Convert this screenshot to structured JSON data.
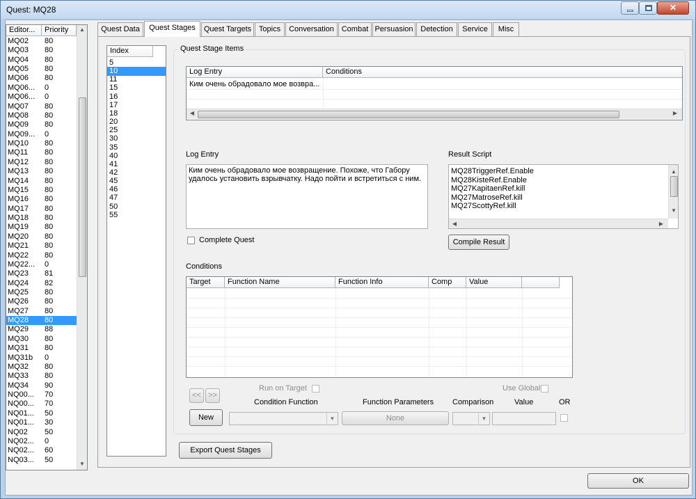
{
  "window": {
    "title": "Quest: MQ28"
  },
  "quest_list": {
    "columns": [
      "Editor...",
      "Priority"
    ],
    "rows": [
      [
        "MQ02",
        "80"
      ],
      [
        "MQ03",
        "80"
      ],
      [
        "MQ04",
        "80"
      ],
      [
        "MQ05",
        "80"
      ],
      [
        "MQ06",
        "80"
      ],
      [
        "MQ06...",
        "0"
      ],
      [
        "MQ06...",
        "0"
      ],
      [
        "MQ07",
        "80"
      ],
      [
        "MQ08",
        "80"
      ],
      [
        "MQ09",
        "80"
      ],
      [
        "MQ09...",
        "0"
      ],
      [
        "MQ10",
        "80"
      ],
      [
        "MQ11",
        "80"
      ],
      [
        "MQ12",
        "80"
      ],
      [
        "MQ13",
        "80"
      ],
      [
        "MQ14",
        "80"
      ],
      [
        "MQ15",
        "80"
      ],
      [
        "MQ16",
        "80"
      ],
      [
        "MQ17",
        "80"
      ],
      [
        "MQ18",
        "80"
      ],
      [
        "MQ19",
        "80"
      ],
      [
        "MQ20",
        "80"
      ],
      [
        "MQ21",
        "80"
      ],
      [
        "MQ22",
        "80"
      ],
      [
        "MQ22...",
        "0"
      ],
      [
        "MQ23",
        "81"
      ],
      [
        "MQ24",
        "82"
      ],
      [
        "MQ25",
        "80"
      ],
      [
        "MQ26",
        "80"
      ],
      [
        "MQ27",
        "80"
      ],
      [
        "MQ28",
        "80"
      ],
      [
        "MQ29",
        "88"
      ],
      [
        "MQ30",
        "80"
      ],
      [
        "MQ31",
        "80"
      ],
      [
        "MQ31b",
        "0"
      ],
      [
        "MQ32",
        "80"
      ],
      [
        "MQ33",
        "80"
      ],
      [
        "MQ34",
        "90"
      ],
      [
        "NQ00...",
        "70"
      ],
      [
        "NQ00...",
        "70"
      ],
      [
        "NQ01...",
        "50"
      ],
      [
        "NQ01...",
        "30"
      ],
      [
        "NQ02",
        "50"
      ],
      [
        "NQ02...",
        "0"
      ],
      [
        "NQ02...",
        "60"
      ],
      [
        "NQ03...",
        "50"
      ]
    ],
    "selected_index": 30
  },
  "tabs": [
    "Quest Data",
    "Quest Stages",
    "Quest Targets",
    "Topics",
    "Conversation",
    "Combat",
    "Persuasion",
    "Detection",
    "Service",
    "Misc"
  ],
  "active_tab": 1,
  "stage_index": {
    "header": "Index",
    "rows": [
      "5",
      "10",
      "11",
      "15",
      "16",
      "17",
      "18",
      "20",
      "25",
      "30",
      "35",
      "40",
      "41",
      "42",
      "45",
      "46",
      "47",
      "50",
      "55"
    ],
    "selected_index": 1
  },
  "stage_items": {
    "group_label": "Quest Stage Items",
    "columns": [
      "Log Entry",
      "Conditions"
    ],
    "rows": [
      [
        "Ким очень обрадовало мое возвра...",
        ""
      ]
    ]
  },
  "log_entry": {
    "label": "Log Entry",
    "text": "Ким очень обрадовало мое возвращение. Похоже, что Габору удалось установить взрывчатку. Надо пойти и встретиться с ним."
  },
  "result_script": {
    "label": "Result Script",
    "lines": [
      "MQ28TriggerRef.Enable",
      "MQ28KisteRef.Enable",
      "MQ27KapitaenRef.kill",
      "MQ27MatroseRef.kill",
      "MQ27ScottyRef.kill"
    ]
  },
  "complete_quest_label": "Complete Quest",
  "compile_result_label": "Compile Result",
  "conditions": {
    "label": "Conditions",
    "columns": [
      "Target",
      "Function Name",
      "Function Info",
      "Comp",
      "Value",
      ""
    ]
  },
  "condition_editor": {
    "prev_label": "<<",
    "next_label": ">>",
    "run_on_target_label": "Run on Target",
    "use_global_label": "Use Global",
    "condition_function_label": "Condition Function",
    "function_parameters_label": "Function Parameters",
    "comparison_label": "Comparison",
    "value_label": "Value",
    "or_label": "OR",
    "new_label": "New",
    "parameters_value": "None"
  },
  "export_label": "Export Quest Stages",
  "ok_label": "OK"
}
